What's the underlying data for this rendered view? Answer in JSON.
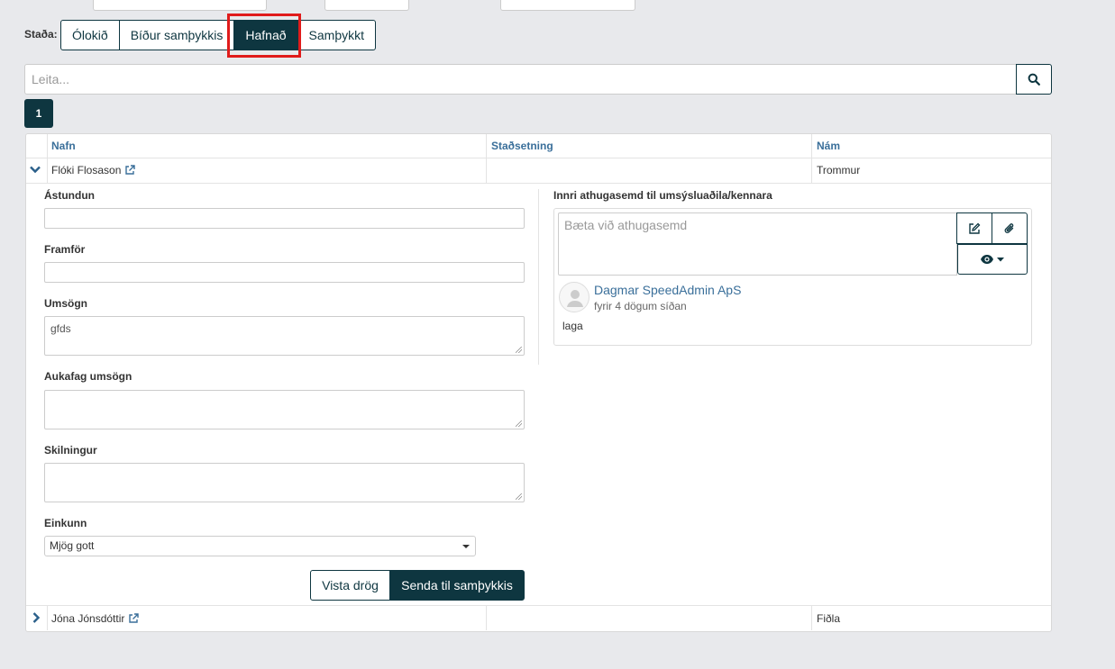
{
  "filters": {
    "status_label": "Staða:",
    "tabs": [
      {
        "label": "Ólokið",
        "active": false
      },
      {
        "label": "Bíður samþykkis",
        "active": false
      },
      {
        "label": "Hafnað",
        "active": true
      },
      {
        "label": "Samþykkt",
        "active": false
      }
    ]
  },
  "search": {
    "placeholder": "Leita..."
  },
  "pagination": {
    "current_page": "1"
  },
  "table": {
    "headers": {
      "name": "Nafn",
      "location": "Staðsetning",
      "study": "Nám"
    },
    "rows": [
      {
        "name": "Flóki Flosason",
        "location": "",
        "study": "Trommur",
        "expanded": true
      },
      {
        "name": "Jóna Jónsdóttir",
        "location": "",
        "study": "Fiðla",
        "expanded": false
      }
    ]
  },
  "detail": {
    "fields": {
      "astundun": {
        "label": "Ástundun",
        "value": ""
      },
      "framfor": {
        "label": "Framför",
        "value": ""
      },
      "umsogn": {
        "label": "Umsögn",
        "value": "gfds"
      },
      "aukafag": {
        "label": "Aukafag umsögn",
        "value": ""
      },
      "skilningur": {
        "label": "Skilningur",
        "value": ""
      },
      "einkunn": {
        "label": "Einkunn",
        "value": "Mjög gott"
      }
    },
    "buttons": {
      "save_draft": "Vista drög",
      "submit": "Senda til samþykkis"
    },
    "notes": {
      "title": "Innri athugasemd til umsýsluaðila/kennara",
      "placeholder": "Bæta við athugasemd",
      "comments": [
        {
          "author": "Dagmar SpeedAdmin ApS",
          "time": "fyrir 4 dögum síðan",
          "text": "laga"
        }
      ]
    }
  },
  "colors": {
    "accent": "#0e3640",
    "header_text": "#3a6f9a",
    "highlight": "#e01b1b",
    "background": "#e8e9ec"
  }
}
